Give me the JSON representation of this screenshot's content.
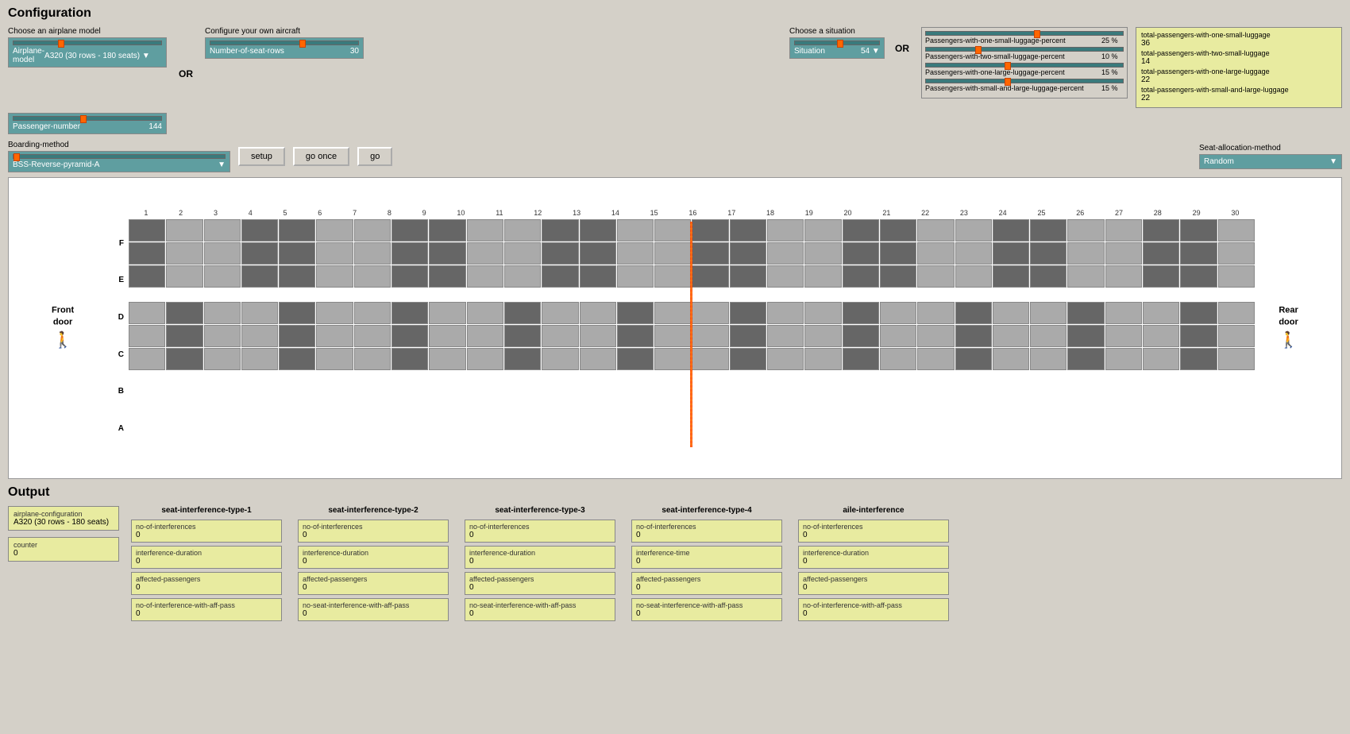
{
  "header": {
    "title": "Configuration"
  },
  "airplane": {
    "choose_label": "Choose an airplane model",
    "model_label": "Airplane-model",
    "model_value": "A320 (30 rows - 180 seats)",
    "configure_label": "Configure your own aircraft",
    "seat_rows_label": "Number-of-seat-rows",
    "seat_rows_value": "30",
    "passenger_label": "Passenger-number",
    "passenger_value": "144",
    "or1": "OR",
    "or2": "OR"
  },
  "situation": {
    "choose_label": "Choose a situation",
    "situation_label": "Situation",
    "situation_value": "54"
  },
  "luggage": {
    "small_one_label": "Passengers-with-one-small-luggage-percent",
    "small_one_pct": "25 %",
    "small_two_label": "Passengers-with-two-small-luggage-percent",
    "small_two_pct": "10 %",
    "large_one_label": "Passengers-with-one-large-luggage-percent",
    "large_one_pct": "15 %",
    "small_large_label": "Passengers-with-small-and-large-luggage-percent",
    "small_large_pct": "15 %"
  },
  "totals": {
    "small_one_label": "total-passengers-with-one-small-luggage",
    "small_one_value": "36",
    "small_two_label": "total-passengers-with-two-small-luggage",
    "small_two_value": "14",
    "large_one_label": "total-passengers-with-one-large-luggage",
    "large_one_value": "22",
    "small_large_label": "total-passengers-with-small-and-large-luggage",
    "small_large_value": "22"
  },
  "boarding": {
    "method_label": "Boarding-method",
    "method_value": "BSS-Reverse-pyramid-A",
    "setup_btn": "setup",
    "go_once_btn": "go once",
    "go_btn": "go",
    "seat_alloc_label": "Seat-allocation-method",
    "seat_alloc_value": "Random"
  },
  "plane_view": {
    "front_door": "Front\ndoor",
    "rear_door": "Rear\ndoor",
    "row_labels": [
      "F",
      "E",
      "D",
      "C",
      "B",
      "A"
    ],
    "col_numbers": [
      "1",
      "2",
      "3",
      "4",
      "5",
      "6",
      "7",
      "8",
      "9",
      "10",
      "11",
      "12",
      "13",
      "14",
      "15",
      "16",
      "17",
      "18",
      "19",
      "20",
      "21",
      "22",
      "23",
      "24",
      "25",
      "26",
      "27",
      "28",
      "29",
      "30"
    ],
    "orange_col": 15
  },
  "output": {
    "title": "Output",
    "config_label": "airplane-configuration",
    "config_value": "A320 (30 rows - 180 seats)",
    "counter_label": "counter",
    "counter_value": "0"
  },
  "interference_groups": [
    {
      "title": "seat-interference-type-1",
      "items": [
        {
          "label": "no-of-interferences",
          "value": "0"
        },
        {
          "label": "interference-duration",
          "value": "0"
        },
        {
          "label": "affected-passengers",
          "value": "0"
        },
        {
          "label": "no-of-interference-with-aff-pass",
          "value": "0"
        }
      ]
    },
    {
      "title": "seat-interference-type-2",
      "items": [
        {
          "label": "no-of-interferences",
          "value": "0"
        },
        {
          "label": "interference-duration",
          "value": "0"
        },
        {
          "label": "affected-passengers",
          "value": "0"
        },
        {
          "label": "no-seat-interference-with-aff-pass",
          "value": "0"
        }
      ]
    },
    {
      "title": "seat-interference-type-3",
      "items": [
        {
          "label": "no-of-interferences",
          "value": "0"
        },
        {
          "label": "interference-duration",
          "value": "0"
        },
        {
          "label": "affected-passengers",
          "value": "0"
        },
        {
          "label": "no-seat-interference-with-aff-pass",
          "value": "0"
        }
      ]
    },
    {
      "title": "seat-interference-type-4",
      "items": [
        {
          "label": "no-of-interferences",
          "value": "0"
        },
        {
          "label": "interference-time",
          "value": "0"
        },
        {
          "label": "affected-passengers",
          "value": "0"
        },
        {
          "label": "no-seat-interference-with-aff-pass",
          "value": "0"
        }
      ]
    },
    {
      "title": "aile-interference",
      "items": [
        {
          "label": "no-of-interferences",
          "value": "0"
        },
        {
          "label": "interference-duration",
          "value": "0"
        },
        {
          "label": "affected-passengers",
          "value": "0"
        },
        {
          "label": "no-of-interference-with-aff-pass",
          "value": "0"
        }
      ]
    }
  ]
}
